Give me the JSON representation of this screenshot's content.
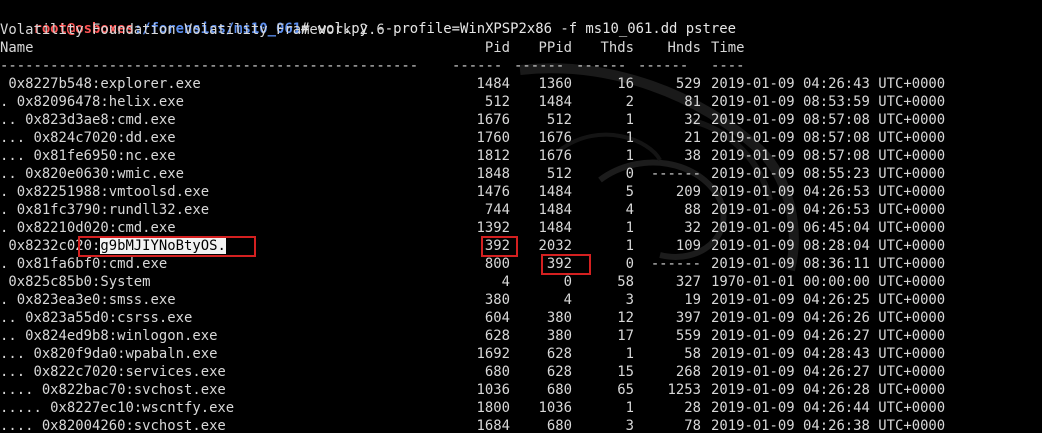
{
  "prompt": {
    "user_host": "root@osboxes",
    "path": ":/forensics/ms10_061",
    "symbol": "#",
    "command": " vol.py --profile=WinXPSP2x86 -f ms10_061.dd pstree"
  },
  "banner": "Volatility Foundation Volatility Framework 2.6",
  "headers": {
    "name": "Name",
    "pid": "Pid",
    "ppid": "PPid",
    "thds": "Thds",
    "hnds": "Hnds",
    "time": "Time"
  },
  "separator": {
    "name": "--------------------------------------------------",
    "pid": "------",
    "ppid": "------",
    "thds": "------",
    "hnds": "------",
    "time": "----"
  },
  "rows": [
    {
      "name": " 0x8227b548:explorer.exe",
      "pid": "1484",
      "ppid": "1360",
      "thds": "16",
      "hnds": "529",
      "time": "2019-01-09 04:26:43 UTC+0000"
    },
    {
      "name": ". 0x82096478:helix.exe",
      "pid": "512",
      "ppid": "1484",
      "thds": "2",
      "hnds": "81",
      "time": "2019-01-09 08:53:59 UTC+0000"
    },
    {
      "name": ".. 0x823d3ae8:cmd.exe",
      "pid": "1676",
      "ppid": "512",
      "thds": "1",
      "hnds": "32",
      "time": "2019-01-09 08:57:08 UTC+0000"
    },
    {
      "name": "... 0x824c7020:dd.exe",
      "pid": "1760",
      "ppid": "1676",
      "thds": "1",
      "hnds": "21",
      "time": "2019-01-09 08:57:08 UTC+0000"
    },
    {
      "name": "... 0x81fe6950:nc.exe",
      "pid": "1812",
      "ppid": "1676",
      "thds": "1",
      "hnds": "38",
      "time": "2019-01-09 08:57:08 UTC+0000"
    },
    {
      "name": ".. 0x820e0630:wmic.exe",
      "pid": "1848",
      "ppid": "512",
      "thds": "0",
      "hnds": "------",
      "time": "2019-01-09 08:55:23 UTC+0000"
    },
    {
      "name": ". 0x82251988:vmtoolsd.exe",
      "pid": "1476",
      "ppid": "1484",
      "thds": "5",
      "hnds": "209",
      "time": "2019-01-09 04:26:53 UTC+0000"
    },
    {
      "name": ". 0x81fc3790:rundll32.exe",
      "pid": "744",
      "ppid": "1484",
      "thds": "4",
      "hnds": "88",
      "time": "2019-01-09 04:26:53 UTC+0000"
    },
    {
      "name": ". 0x82210d020:cmd.exe",
      "pid": "1392",
      "ppid": "1484",
      "thds": "1",
      "hnds": "32",
      "time": "2019-01-09 06:45:04 UTC+0000"
    },
    {
      "name": " 0x8232c020:",
      "name_highlight": "g9bMJIYNoBtyOS.",
      "pid": "392",
      "ppid": "2032",
      "thds": "1",
      "hnds": "109",
      "time": "2019-01-09 08:28:04 UTC+0000"
    },
    {
      "name": ". 0x81fa6bf0:cmd.exe",
      "pid": "800",
      "ppid": "392",
      "thds": "0",
      "hnds": "------",
      "time": "2019-01-09 08:36:11 UTC+0000"
    },
    {
      "name": " 0x825c85b0:System",
      "pid": "4",
      "ppid": "0",
      "thds": "58",
      "hnds": "327",
      "time": "1970-01-01 00:00:00 UTC+0000"
    },
    {
      "name": ". 0x823ea3e0:smss.exe",
      "pid": "380",
      "ppid": "4",
      "thds": "3",
      "hnds": "19",
      "time": "2019-01-09 04:26:25 UTC+0000"
    },
    {
      "name": ".. 0x823a55d0:csrss.exe",
      "pid": "604",
      "ppid": "380",
      "thds": "12",
      "hnds": "397",
      "time": "2019-01-09 04:26:26 UTC+0000"
    },
    {
      "name": ".. 0x824ed9b8:winlogon.exe",
      "pid": "628",
      "ppid": "380",
      "thds": "17",
      "hnds": "559",
      "time": "2019-01-09 04:26:27 UTC+0000"
    },
    {
      "name": "... 0x820f9da0:wpabaln.exe",
      "pid": "1692",
      "ppid": "628",
      "thds": "1",
      "hnds": "58",
      "time": "2019-01-09 04:28:43 UTC+0000"
    },
    {
      "name": "... 0x822c7020:services.exe",
      "pid": "680",
      "ppid": "628",
      "thds": "15",
      "hnds": "268",
      "time": "2019-01-09 04:26:27 UTC+0000"
    },
    {
      "name": ".... 0x822bac70:svchost.exe",
      "pid": "1036",
      "ppid": "680",
      "thds": "65",
      "hnds": "1253",
      "time": "2019-01-09 04:26:28 UTC+0000"
    },
    {
      "name": "..... 0x8227ec10:wscntfy.exe",
      "pid": "1800",
      "ppid": "1036",
      "thds": "1",
      "hnds": "28",
      "time": "2019-01-09 04:26:44 UTC+0000"
    },
    {
      "name": ".... 0x82004260:svchost.exe",
      "pid": "1684",
      "ppid": "680",
      "thds": "3",
      "hnds": "78",
      "time": "2019-01-09 04:26:38 UTC+0000"
    }
  ],
  "colors": {
    "background": "#000000",
    "text": "#d8d8d8",
    "prompt_user": "#ff5555",
    "prompt_path": "#5c8ff0",
    "highlight_box": "#d42020",
    "highlight_text_bg": "#f2f2f2"
  }
}
